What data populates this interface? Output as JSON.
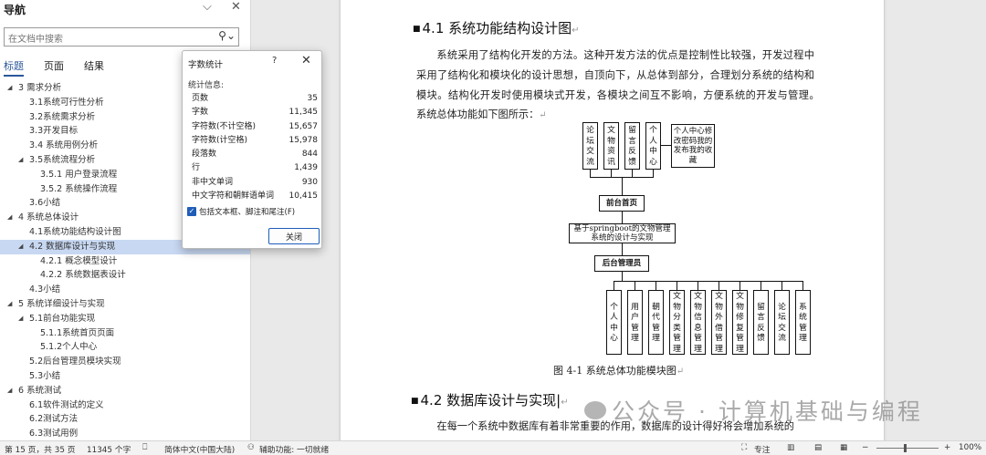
{
  "nav": {
    "title": "导航",
    "search_placeholder": "在文档中搜索",
    "tabs": [
      "标题",
      "页面",
      "结果"
    ],
    "outline": [
      {
        "text": "3 需求分析",
        "level": 1,
        "expanded": true
      },
      {
        "text": "3.1系统可行性分析",
        "level": 2
      },
      {
        "text": "3.2系统需求分析",
        "level": 2
      },
      {
        "text": "3.3开发目标",
        "level": 2
      },
      {
        "text": "3.4 系统用例分析",
        "level": 2
      },
      {
        "text": "3.5系统流程分析",
        "level": 2,
        "expanded": true
      },
      {
        "text": "3.5.1 用户登录流程",
        "level": 3
      },
      {
        "text": "3.5.2 系统操作流程",
        "level": 3
      },
      {
        "text": "3.6小结",
        "level": 2
      },
      {
        "text": "4 系统总体设计",
        "level": 1,
        "expanded": true
      },
      {
        "text": "4.1系统功能结构设计图",
        "level": 2
      },
      {
        "text": "4.2 数据库设计与实现",
        "level": 2,
        "expanded": true,
        "selected": true
      },
      {
        "text": "4.2.1 概念模型设计",
        "level": 3
      },
      {
        "text": "4.2.2 系统数据表设计",
        "level": 3
      },
      {
        "text": "4.3小结",
        "level": 2
      },
      {
        "text": "5 系统详细设计与实现",
        "level": 1,
        "expanded": true
      },
      {
        "text": "5.1前台功能实现",
        "level": 2,
        "expanded": true
      },
      {
        "text": "5.1.1系统首页页面",
        "level": 3
      },
      {
        "text": "5.1.2个人中心",
        "level": 3
      },
      {
        "text": "5.2后台管理员模块实现",
        "level": 2
      },
      {
        "text": "5.3小结",
        "level": 2
      },
      {
        "text": "6 系统测试",
        "level": 1,
        "expanded": true
      },
      {
        "text": "6.1软件测试的定义",
        "level": 2
      },
      {
        "text": "6.2测试方法",
        "level": 2
      },
      {
        "text": "6.3测试用例",
        "level": 2
      }
    ]
  },
  "dialog": {
    "title": "字数统计",
    "help": "?",
    "stats_label": "统计信息:",
    "stats": [
      {
        "label": "页数",
        "value": "35"
      },
      {
        "label": "字数",
        "value": "11,345"
      },
      {
        "label": "字符数(不计空格)",
        "value": "15,657"
      },
      {
        "label": "字符数(计空格)",
        "value": "15,978"
      },
      {
        "label": "段落数",
        "value": "844"
      },
      {
        "label": "行",
        "value": "1,439"
      },
      {
        "label": "非中文单词",
        "value": "930"
      },
      {
        "label": "中文字符和朝鲜语单词",
        "value": "10,415"
      }
    ],
    "checkbox_label": "包括文本框、脚注和尾注(F)",
    "checkbox_checked": true,
    "close_button": "关闭"
  },
  "document": {
    "heading1": "4.1 系统功能结构设计图",
    "paragraph1": "系统采用了结构化开发的方法。这种开发方法的优点是控制性比较强，开发过程中采用了结构化和模块化的设计思想，自顶向下，从总体到部分，合理划分系统的结构和模块。结构化开发时使用模块式开发，各模块之间互不影响，方便系统的开发与管理。　系统总体功能如下图所示：",
    "diagram": {
      "front_modules": [
        "论坛交流",
        "文物资讯",
        "留言反馈",
        "个人中心"
      ],
      "front_sub": "个人中心修改密码我的发布我的收藏",
      "front_home": "前台首页",
      "system": "基于springboot的文物管理系统的设计与实现",
      "admin": "后台管理员",
      "admin_modules": [
        "个人中心",
        "用户管理",
        "朝代管理",
        "文物分类管理",
        "文物信息管理",
        "文物外借管理",
        "文物修复管理",
        "留言反馈",
        "论坛交流",
        "系统管理"
      ]
    },
    "caption": "图 4-1 系统总体功能模块图",
    "heading2": "4.2  数据库设计与实现",
    "paragraph2": "在每一个系统中数据库有着非常重要的作用，数据库的设计得好将会增加系统的",
    "para_mark": "↵"
  },
  "watermark": "公众号 · 计算机基础与编程",
  "status": {
    "page": "第 15 页，共 35 页",
    "words": "11345 个字",
    "language": "简体中文(中国大陆)",
    "accessibility": "辅助功能: 一切就绪",
    "focus": "专注",
    "zoom": "100%"
  }
}
